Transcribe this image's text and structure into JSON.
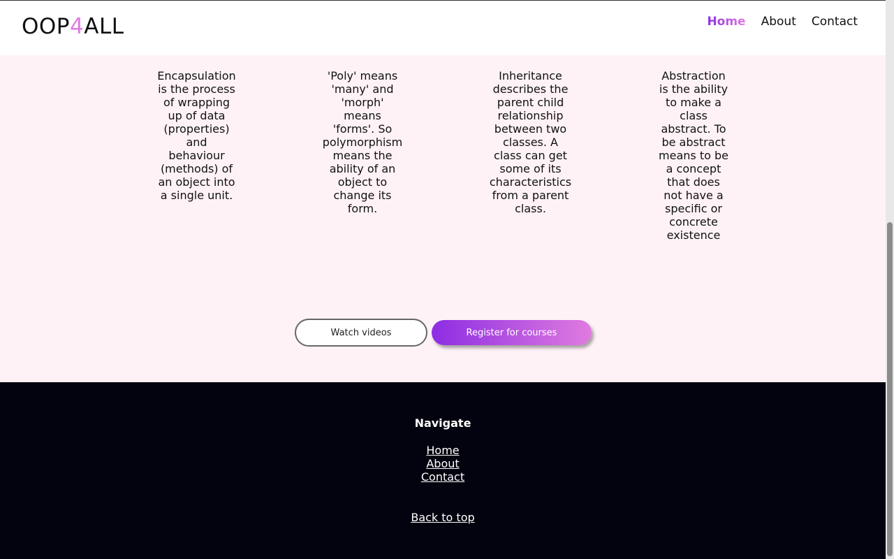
{
  "header": {
    "logo": {
      "prefix": "OOP",
      "accent": "4",
      "suffix": "ALL"
    },
    "nav": [
      {
        "label": "Home",
        "active": true
      },
      {
        "label": "About",
        "active": false
      },
      {
        "label": "Contact",
        "active": false
      }
    ]
  },
  "pillars": [
    {
      "text": "Encapsulation is the process of wrapping up of data (properties) and behaviour (methods) of an object into a single unit."
    },
    {
      "text": "'Poly' means 'many' and 'morph' means 'forms'. So polymorphism means the ability of an object to change its form."
    },
    {
      "text": "Inheritance describes the parent child relationship between two classes. A class can get some of its characteristics from a parent class."
    },
    {
      "text": "Abstraction is the ability to make a class abstract. To be abstract means to be a concept that does not have a specific or concrete existence"
    }
  ],
  "actions": {
    "watch_videos": "Watch videos",
    "register": "Register for courses"
  },
  "footer": {
    "title": "Navigate",
    "links": [
      "Home",
      "About",
      "Contact"
    ],
    "back_to_top": "Back to top"
  },
  "colors": {
    "accent_start": "#8d2de2",
    "accent_end": "#e07be0",
    "page_bg": "#fef2f7",
    "footer_bg": "#03020f"
  }
}
